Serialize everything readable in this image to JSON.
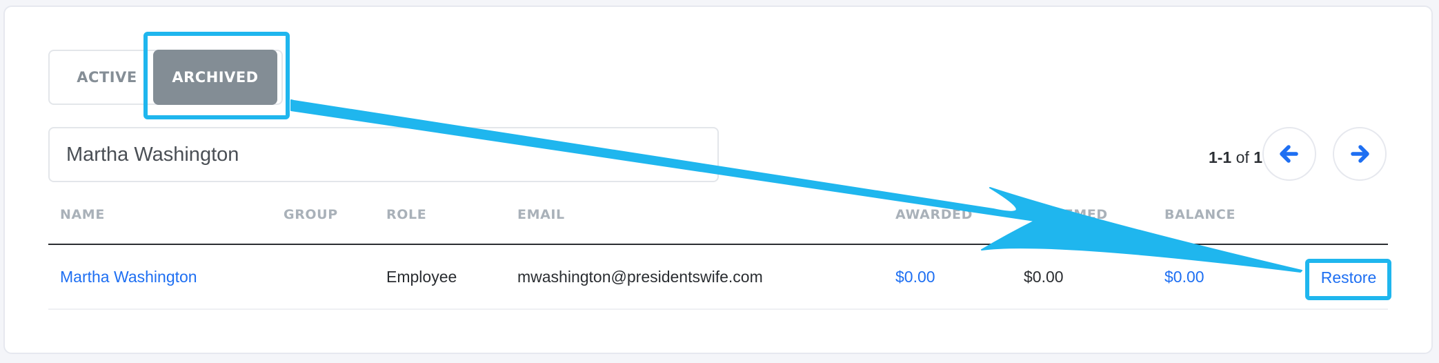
{
  "tabs": [
    {
      "label": "ACTIVE",
      "selected": false
    },
    {
      "label": "ARCHIVED",
      "selected": true
    }
  ],
  "search": {
    "value": "Martha Washington"
  },
  "pagination": {
    "range": "1-1",
    "of_label": "of",
    "total": "1"
  },
  "table": {
    "columns": [
      "NAME",
      "GROUP",
      "ROLE",
      "EMAIL",
      "AWARDED",
      "REDEEMED",
      "BALANCE"
    ],
    "rows": [
      {
        "name": "Martha Washington",
        "group": "",
        "role": "Employee",
        "email": "mwashington@presidentswife.com",
        "awarded": "$0.00",
        "redeemed": "$0.00",
        "balance": "$0.00",
        "action": "Restore"
      }
    ]
  },
  "icons": {
    "prev": "arrow-left-icon",
    "next": "arrow-right-icon"
  },
  "colors": {
    "link": "#1e6ff2",
    "tab_selected_bg": "#838d95",
    "annotation": "#1fb6ee"
  }
}
